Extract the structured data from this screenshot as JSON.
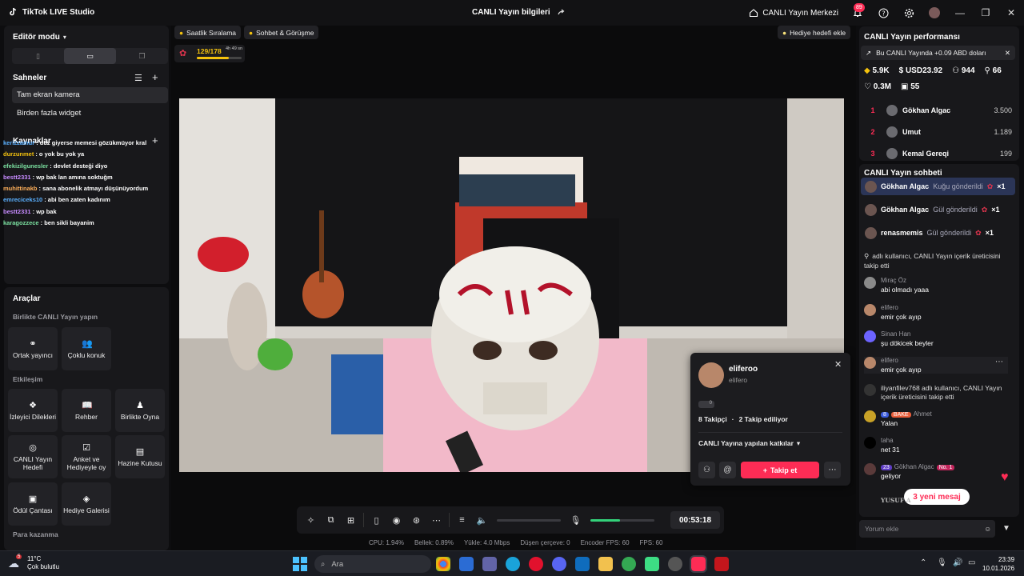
{
  "app": {
    "title": "TikTok LIVE Studio",
    "center_title": "CANLI Yayın bilgileri",
    "live_center": "CANLI Yayın Merkezi",
    "notif_count": "89"
  },
  "left": {
    "editor_mode": "Editör modu",
    "scenes_title": "Sahneler",
    "scenes": [
      "Tam ekran kamera",
      "Birden fazla widget"
    ],
    "sources_title": "Kaynaklar",
    "chat_overlay": [
      {
        "user": "kerizzamur",
        "text": ": düz giyerse memesi gözükmüyor kral",
        "color": "#5ab0ff"
      },
      {
        "user": "durzunmet",
        "text": ": o yok bu yok ya",
        "color": "#f4c20d"
      },
      {
        "user": "efekizilgunesler",
        "text": ": devlet desteği diyo",
        "color": "#7be0a0"
      },
      {
        "user": "bestt2331",
        "text": ": wp bak lan amına soktuğm",
        "color": "#c78bff"
      },
      {
        "user": "muhittinakb",
        "text": ": sana abonelik atmayı düşünüyordum",
        "color": "#ffb05a"
      },
      {
        "user": "emreciceks10",
        "text": ": abi ben zaten kadınım",
        "color": "#5ab0ff"
      },
      {
        "user": "bestt2331",
        "text": ": wp bak",
        "color": "#c78bff"
      },
      {
        "user": "karagozzece",
        "text": ": ben sikli bayanim",
        "color": "#7be0a0"
      }
    ],
    "tools_title": "Araçlar",
    "together_label": "Birlikte CANLI Yayın yapın",
    "together_tools": [
      "Ortak yayıncı",
      "Çoklu konuk"
    ],
    "interaction_label": "Etkileşim",
    "interaction_tools": [
      "İzleyici Dilekleri",
      "Rehber",
      "Birlikte Oyna",
      "CANLI Yayın Hedefi",
      "Anket ve Hediyeyle oy",
      "Hazine Kutusu",
      "Ödül Çantası",
      "Hediye Galerisi"
    ],
    "monetize_label": "Para kazanma"
  },
  "center": {
    "chip_ranking": "Saatlik Sıralama",
    "chip_chat": "Sohbet & Görüşme",
    "gift_goal_btn": "Hediye hedefi ekle",
    "goal_count": "129/178",
    "goal_time": "4h 49 sn",
    "goal_progress": 0.72
  },
  "profile_card": {
    "name": "eliferoo",
    "handle": "elifero",
    "level": "0",
    "followers": "8 Takipçi",
    "following": "2 Takip ediliyor",
    "contrib": "CANLI Yayına yapılan katkılar",
    "follow_btn": "Takip et"
  },
  "controls": {
    "timer": "00:53:18"
  },
  "stats": [
    "CPU: 1.94%",
    "Bellek: 0.89%",
    "Yükle: 4.0 Mbps",
    "Düşen çerçeve: 0",
    "Encoder FPS: 60",
    "FPS: 60"
  ],
  "right": {
    "perf_title": "CANLI Yayın performansı",
    "notice": "Bu CANLI Yayında +0.09 ABD doları",
    "metrics_row1": [
      "5.9K",
      "USD23.92",
      "944",
      "66"
    ],
    "metrics_row2": [
      "0.3M",
      "55"
    ],
    "ranking": [
      {
        "rank": "1",
        "name": "Gökhan Algac",
        "value": "3.500"
      },
      {
        "rank": "2",
        "name": "Umut",
        "value": "1.189"
      },
      {
        "rank": "3",
        "name": "Kemal Gereqi",
        "value": "199"
      }
    ],
    "chat_title": "CANLI Yayın sohbeti",
    "gifts": [
      {
        "user": "Gökhan Algac",
        "action": "Kuğu gönderildi",
        "count": "×1"
      },
      {
        "user": "Gökhan Algac",
        "action": "Gül gönderildi",
        "count": "×1"
      },
      {
        "user": "renasmemis",
        "action": "Gül gönderildi",
        "count": "×1"
      }
    ],
    "messages": [
      {
        "name": "Miraç Öz",
        "text": "abi olmadı yaaa"
      },
      {
        "name": "elifero",
        "text": "emir çok ayıp"
      },
      {
        "name": "Sinan Han",
        "text": "şu dökicek beyler"
      },
      {
        "name": "elifero",
        "text": "emir çok ayıp"
      },
      {
        "name": "",
        "text": "iliyanfilev768  adlı kullanıcı, CANLI Yayın içerik üreticisini takip etti"
      },
      {
        "name": "Ahmet",
        "text": "Yalan"
      },
      {
        "name": "taha",
        "text": "net 31"
      },
      {
        "name": "Gökhan Algac",
        "text": "geliyor"
      }
    ],
    "partial_follow": "adlı kullanıcı, CANLI Yayın içerik üreticisini takip etti",
    "badge_bake": "BAKE",
    "badge_lv8": "8",
    "badge_lv23": "23",
    "badge_no1": "No. 1",
    "last_user": "YUSUF A",
    "new_messages": "3 yeni mesaj",
    "comment_placeholder": "Yorum ekle"
  },
  "taskbar": {
    "temp": "11°C",
    "weather": "Çok bulutlu",
    "weather_badge": "5",
    "search": "Ara",
    "time": "23:39",
    "date": "10.01.2026"
  },
  "colors": {
    "accent": "#fe2c55",
    "panel": "#18181b",
    "bg": "#0d0d0f"
  }
}
